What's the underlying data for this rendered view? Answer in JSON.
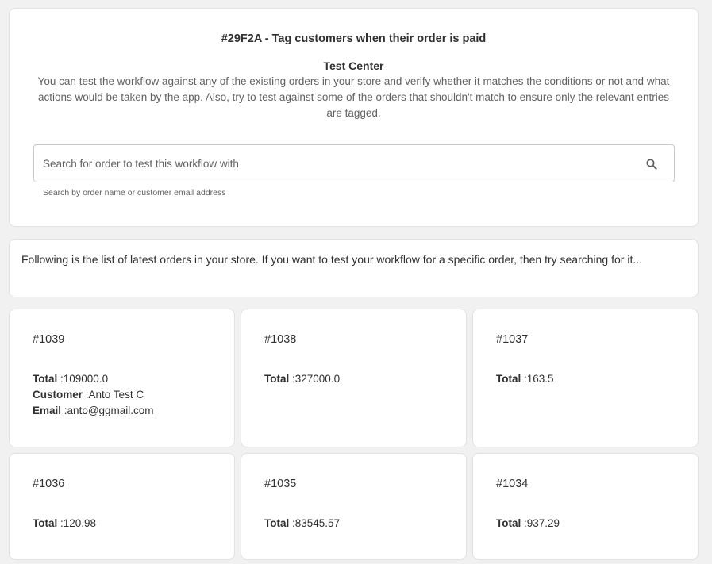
{
  "workflow": {
    "title": "#29F2A - Tag customers when their order is paid"
  },
  "test_center": {
    "title": "Test Center",
    "description": "You can test the workflow against any of the existing orders in your store and verify whether it matches the conditions or not and what actions would be taken by the app. Also, try to test against some of the orders that shouldn't match to ensure only the relevant entries are tagged.",
    "search": {
      "placeholder": "Search for order to test this workflow with",
      "value": "",
      "helper": "Search by order name or customer email address",
      "icon": "search-icon"
    }
  },
  "info": {
    "text": "Following is the list of latest orders in your store. If you want to test your workflow for a specific order, then try searching for it..."
  },
  "labels": {
    "total": "Total",
    "customer": "Customer",
    "email": "Email",
    "separator": " :"
  },
  "orders": [
    {
      "id": "#1039",
      "total": "109000.0",
      "customer": "Anto Test C",
      "email": "anto@ggmail.com"
    },
    {
      "id": "#1038",
      "total": "327000.0"
    },
    {
      "id": "#1037",
      "total": "163.5"
    },
    {
      "id": "#1036",
      "total": "120.98"
    },
    {
      "id": "#1035",
      "total": "83545.57"
    },
    {
      "id": "#1034",
      "total": "937.29"
    }
  ]
}
